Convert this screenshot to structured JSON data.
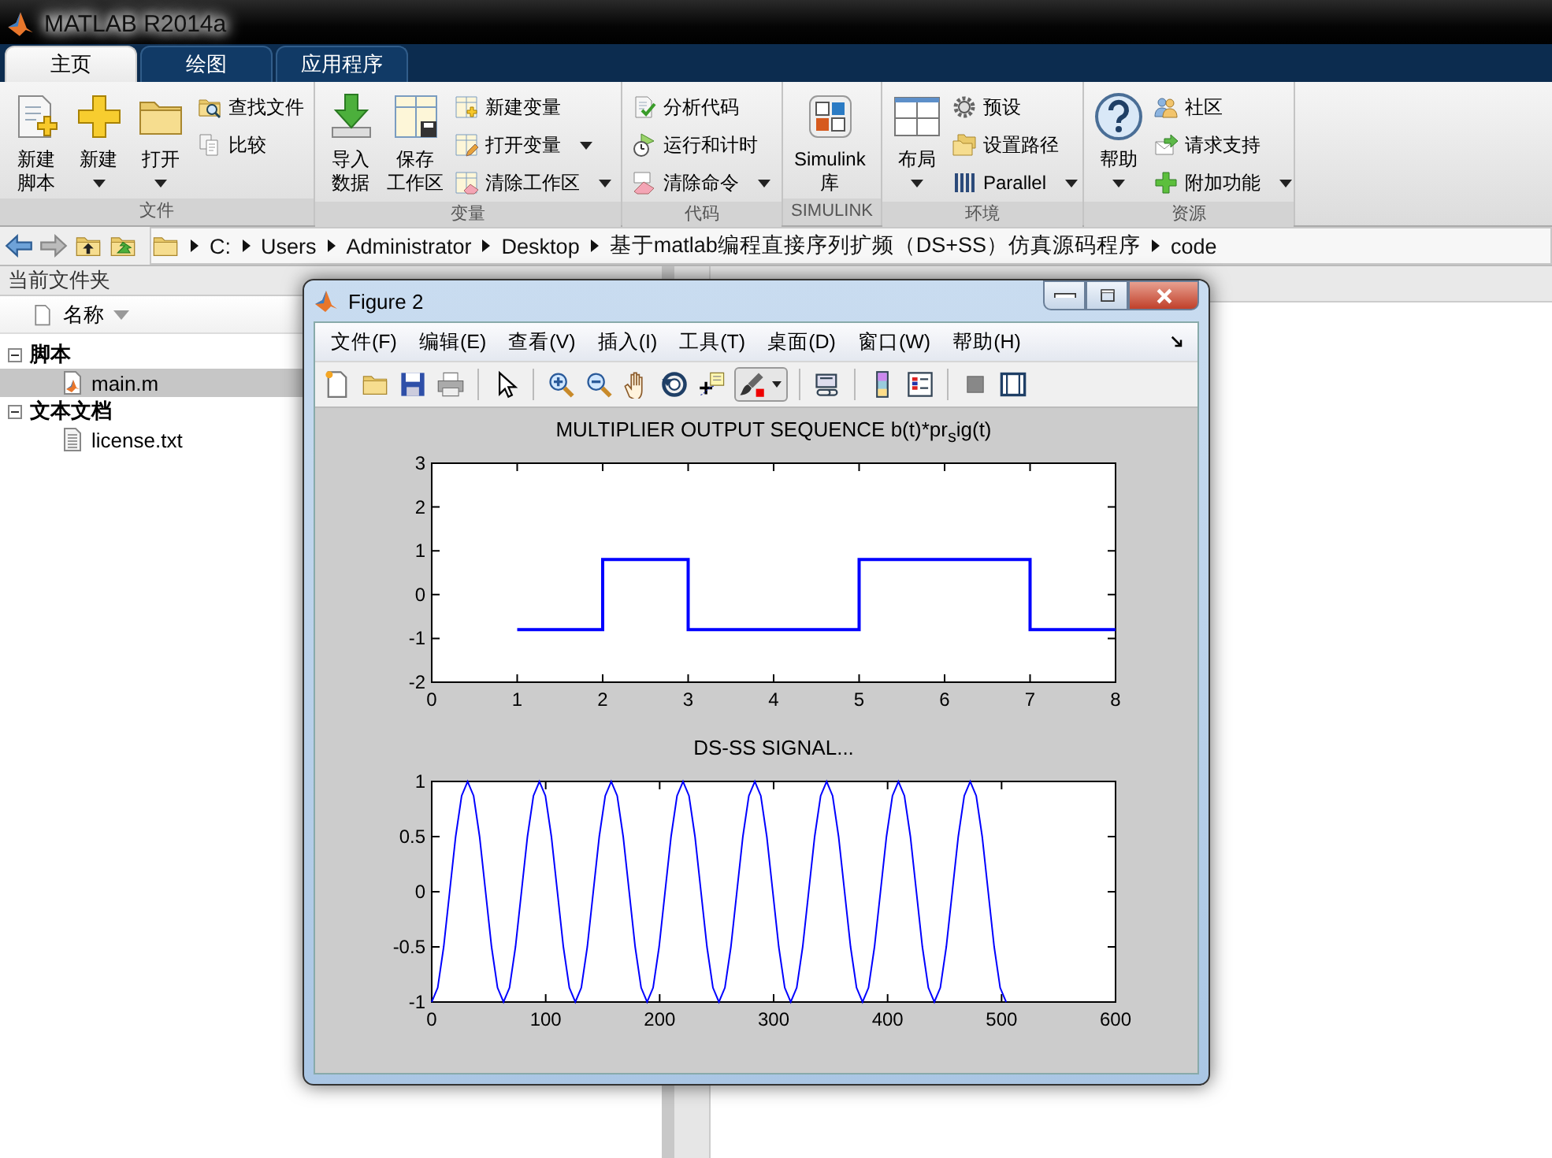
{
  "app_title": "MATLAB R2014a",
  "tabs": [
    {
      "label": "主页",
      "selected": true
    },
    {
      "label": "绘图",
      "selected": false
    },
    {
      "label": "应用程序",
      "selected": false
    }
  ],
  "ribbon": {
    "groups": [
      {
        "label": "文件",
        "items": [
          {
            "kind": "large",
            "label": [
              "新建",
              "脚本"
            ],
            "dropdown": false
          },
          {
            "kind": "large",
            "label": [
              "新建"
            ],
            "dropdown": true
          },
          {
            "kind": "large",
            "label": [
              "打开"
            ],
            "dropdown": true
          },
          {
            "kind": "stack",
            "items": [
              {
                "label": "查找文件",
                "dropdown": false
              },
              {
                "label": "比较",
                "dropdown": false
              }
            ]
          }
        ]
      },
      {
        "label": "变量",
        "items": [
          {
            "kind": "large",
            "label": [
              "导入",
              "数据"
            ],
            "dropdown": false
          },
          {
            "kind": "large",
            "label": [
              "保存",
              "工作区"
            ],
            "dropdown": false
          },
          {
            "kind": "stack",
            "items": [
              {
                "label": "新建变量",
                "dropdown": false
              },
              {
                "label": "打开变量",
                "dropdown": true
              },
              {
                "label": "清除工作区",
                "dropdown": true
              }
            ]
          }
        ]
      },
      {
        "label": "代码",
        "items": [
          {
            "kind": "stack",
            "items": [
              {
                "label": "分析代码",
                "dropdown": false
              },
              {
                "label": "运行和计时",
                "dropdown": false
              },
              {
                "label": "清除命令",
                "dropdown": true
              }
            ]
          }
        ]
      },
      {
        "label": "SIMULINK",
        "items": [
          {
            "kind": "large",
            "label": [
              "Simulink",
              "库"
            ],
            "dropdown": false
          }
        ]
      },
      {
        "label": "环境",
        "items": [
          {
            "kind": "large",
            "label": [
              "布局"
            ],
            "dropdown": true
          },
          {
            "kind": "stack",
            "items": [
              {
                "label": "预设",
                "dropdown": false
              },
              {
                "label": "设置路径",
                "dropdown": false
              },
              {
                "label": "Parallel",
                "dropdown": true
              }
            ]
          }
        ]
      },
      {
        "label": "资源",
        "items": [
          {
            "kind": "large",
            "label": [
              "帮助"
            ],
            "dropdown": true
          },
          {
            "kind": "stack",
            "items": [
              {
                "label": "社区",
                "dropdown": false
              },
              {
                "label": "请求支持",
                "dropdown": false
              },
              {
                "label": "附加功能",
                "dropdown": true
              }
            ]
          }
        ]
      }
    ]
  },
  "address": {
    "segments": [
      "C:",
      "Users",
      "Administrator",
      "Desktop",
      "基于matlab编程直接序列扩频（DS+SS）仿真源码程序",
      "code"
    ]
  },
  "current_folder": {
    "title": "当前文件夹",
    "column": "名称",
    "groups": [
      {
        "label": "脚本",
        "expanded": true,
        "children": [
          {
            "label": "main.m",
            "selected": true
          }
        ]
      },
      {
        "label": "文本文档",
        "expanded": true,
        "children": [
          {
            "label": "license.txt",
            "selected": false
          }
        ]
      }
    ]
  },
  "figure": {
    "title": "Figure 2",
    "menu": [
      "文件(F)",
      "编辑(E)",
      "查看(V)",
      "插入(I)",
      "工具(T)",
      "桌面(D)",
      "窗口(W)",
      "帮助(H)"
    ],
    "plots": [
      {
        "chart_data": {
          "type": "line",
          "title": "MULTIPLIER OUTPUT SEQUENCE b(t)*pr$_{s}$ig(t)",
          "x": [
            1,
            2,
            2,
            3,
            3,
            5,
            5,
            7,
            7,
            8
          ],
          "series": [
            {
              "color": "#0000ff",
              "values": [
                -0.8,
                -0.8,
                0.8,
                0.8,
                -0.8,
                -0.8,
                0.8,
                0.8,
                -0.8,
                -0.8
              ]
            }
          ],
          "xlim": [
            0,
            8
          ],
          "ylim": [
            -2,
            3
          ],
          "xticks": [
            0,
            1,
            2,
            3,
            4,
            5,
            6,
            7,
            8
          ],
          "yticks": [
            -2,
            -1,
            0,
            1,
            2,
            3
          ]
        }
      },
      {
        "chart_data": {
          "type": "line",
          "title": "DS-SS SIGNAL...",
          "x": [
            0,
            5.25,
            10.5,
            15.75,
            21,
            26.25,
            31.5,
            36.75,
            42,
            47.25,
            52.5,
            57.75,
            63,
            68.25,
            73.5,
            78.75,
            84,
            89.25,
            94.5,
            99.75,
            105,
            110.25,
            115.5,
            120.75,
            126,
            131.25,
            136.5,
            141.75,
            147,
            152.25,
            157.5,
            162.75,
            168,
            173.25,
            178.5,
            183.75,
            189,
            194.25,
            199.5,
            204.75,
            210,
            215.25,
            220.5,
            225.75,
            231,
            236.25,
            241.5,
            246.75,
            252,
            257.25,
            262.5,
            267.75,
            273,
            278.25,
            283.5,
            288.75,
            294,
            299.25,
            304.5,
            309.75,
            315,
            320.25,
            325.5,
            330.75,
            336,
            341.25,
            346.5,
            351.75,
            357,
            362.25,
            367.5,
            372.75,
            378,
            383.25,
            388.5,
            393.75,
            399,
            404.25,
            409.5,
            414.75,
            420,
            425.25,
            430.5,
            435.75,
            441,
            446.25,
            451.5,
            456.75,
            462,
            467.25,
            472.5,
            477.75,
            483,
            488.25,
            493.5,
            498.75,
            504
          ],
          "series": [
            {
              "color": "#0000ff",
              "values": [
                -1,
                -0.87,
                -0.5,
                0,
                0.5,
                0.87,
                1,
                0.87,
                0.5,
                0,
                -0.5,
                -0.87,
                -1,
                -0.87,
                -0.5,
                0,
                0.5,
                0.87,
                1,
                0.87,
                0.5,
                0,
                -0.5,
                -0.87,
                -1,
                -0.87,
                -0.5,
                0,
                0.5,
                0.87,
                1,
                0.87,
                0.5,
                0,
                -0.5,
                -0.87,
                -1,
                -0.87,
                -0.5,
                0,
                0.5,
                0.87,
                1,
                0.87,
                0.5,
                0,
                -0.5,
                -0.87,
                -1,
                -0.87,
                -0.5,
                0,
                0.5,
                0.87,
                1,
                0.87,
                0.5,
                0,
                -0.5,
                -0.87,
                -1,
                -0.87,
                -0.5,
                0,
                0.5,
                0.87,
                1,
                0.87,
                0.5,
                0,
                -0.5,
                -0.87,
                -1,
                -0.87,
                -0.5,
                0,
                0.5,
                0.87,
                1,
                0.87,
                0.5,
                0,
                -0.5,
                -0.87,
                -1,
                -0.87,
                -0.5,
                0,
                0.5,
                0.87,
                1,
                0.87,
                0.5,
                0,
                -0.5,
                -0.87,
                -1
              ]
            }
          ],
          "xlim": [
            0,
            600
          ],
          "ylim": [
            -1,
            1
          ],
          "xticks": [
            0,
            100,
            200,
            300,
            400,
            500,
            600
          ],
          "yticks": [
            -1,
            -0.5,
            0,
            0.5,
            1
          ]
        }
      }
    ]
  }
}
